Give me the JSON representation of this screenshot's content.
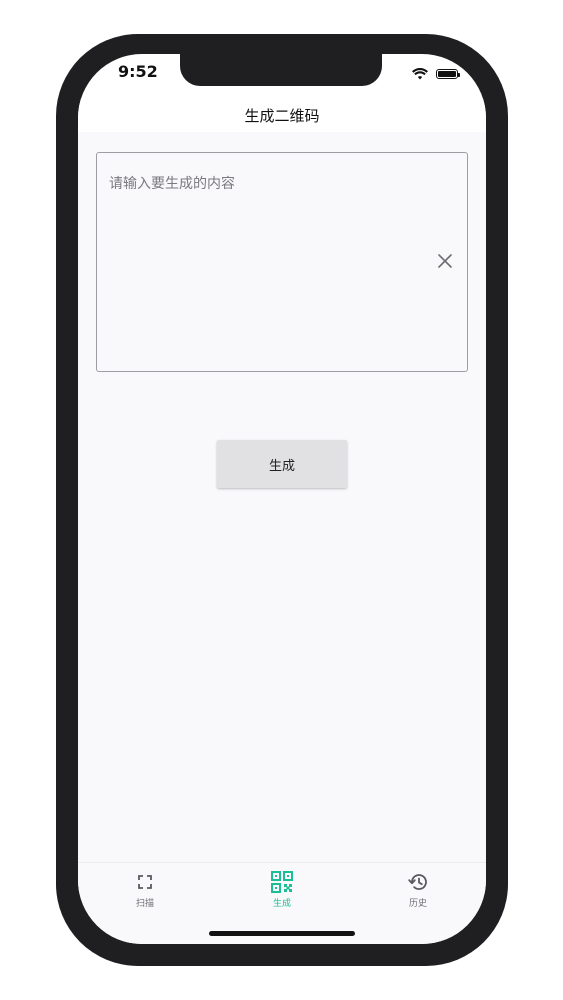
{
  "status_bar": {
    "time": "9:52"
  },
  "nav": {
    "title": "生成二维码"
  },
  "input": {
    "placeholder": "请输入要生成的内容",
    "value": ""
  },
  "generate_button": {
    "label": "生成"
  },
  "tabs": [
    {
      "label": "扫描",
      "icon": "scan-icon",
      "active": false
    },
    {
      "label": "生成",
      "icon": "qr-code-icon",
      "active": true
    },
    {
      "label": "历史",
      "icon": "history-icon",
      "active": false
    }
  ],
  "colors": {
    "accent": "#1bbf95",
    "frame": "#1f1e21",
    "background": "#f9f8fb"
  }
}
